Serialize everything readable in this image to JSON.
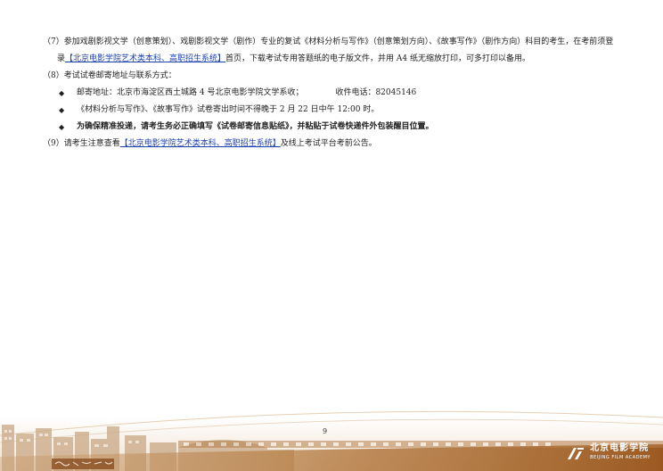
{
  "items": {
    "item7_line1": "（7）参加戏剧影视文学（创意策划）、戏剧影视文学（剧作）专业的复试《材料分析与写作》（创意策划方向）、《故事写作》（剧作方向）科目的考生，在考前须登",
    "item7_prefix": "录",
    "item7_link": "【北京电影学院艺术类本科、高职招生系统】",
    "item7_suffix": "首页，下载考试专用答题纸的电子版文件，并用 A4 纸无缩放打印，可多打印以备用。",
    "item8_title": "（8）考试试卷邮寄地址与联系方式：",
    "bullet1_address": "邮寄地址：北京市海淀区西土城路 4 号北京电影学院文学系收；",
    "bullet1_phone": "收件电话：82045146",
    "bullet2": "《材料分析与写作》、《故事写作》试卷寄出时间不得晚于 2 月 22 日中午 12:00 时。",
    "bullet3": "为确保精准投递，请考生务必正确填写《试卷邮寄信息贴纸》，并粘贴于试卷快递件外包装醒目位置。",
    "item9_prefix": "（9）请考生注意查看",
    "item9_link": "【北京电影学院艺术类本科、高职招生系统】",
    "item9_suffix": "及线上考试平台考前公告。",
    "bullet_glyph": "◆"
  },
  "footer": {
    "page_number": "9",
    "logo_cn": "北京电影学院",
    "logo_en": "BEIJING FILM ACADEMY"
  },
  "colors": {
    "footer_band": "#a9682f",
    "link": "#1a3fb0"
  }
}
